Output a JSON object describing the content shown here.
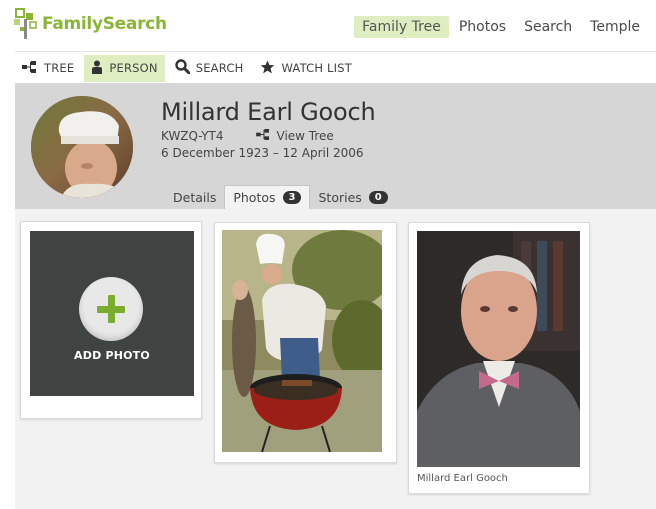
{
  "brand": {
    "name": "FamilySearch",
    "color": "#8bb536"
  },
  "top_nav": [
    {
      "label": "Family Tree",
      "active": true
    },
    {
      "label": "Photos",
      "active": false
    },
    {
      "label": "Search",
      "active": false
    },
    {
      "label": "Temple",
      "active": false
    }
  ],
  "sub_nav": [
    {
      "label": "TREE",
      "icon": "tree-icon",
      "active": false
    },
    {
      "label": "PERSON",
      "icon": "person-icon",
      "active": true
    },
    {
      "label": "SEARCH",
      "icon": "search-icon",
      "active": false
    },
    {
      "label": "WATCH LIST",
      "icon": "star-icon",
      "active": false
    }
  ],
  "person": {
    "name": "Millard Earl Gooch",
    "pid": "KWZQ-YT4",
    "view_tree_label": "View Tree",
    "dates": "6 December 1923 – 12 April 2006"
  },
  "tabs": [
    {
      "label": "Details",
      "count": null,
      "active": false
    },
    {
      "label": "Photos",
      "count": "3",
      "active": true
    },
    {
      "label": "Stories",
      "count": "0",
      "active": false
    }
  ],
  "photos": {
    "add_label": "ADD PHOTO",
    "items": [
      {
        "caption": ""
      },
      {
        "caption": "Millard Earl Gooch"
      }
    ]
  },
  "colors": {
    "accent_green": "#7aad2e",
    "active_tab_bg": "#dfeec0",
    "header_bg": "#d6d6d6"
  }
}
